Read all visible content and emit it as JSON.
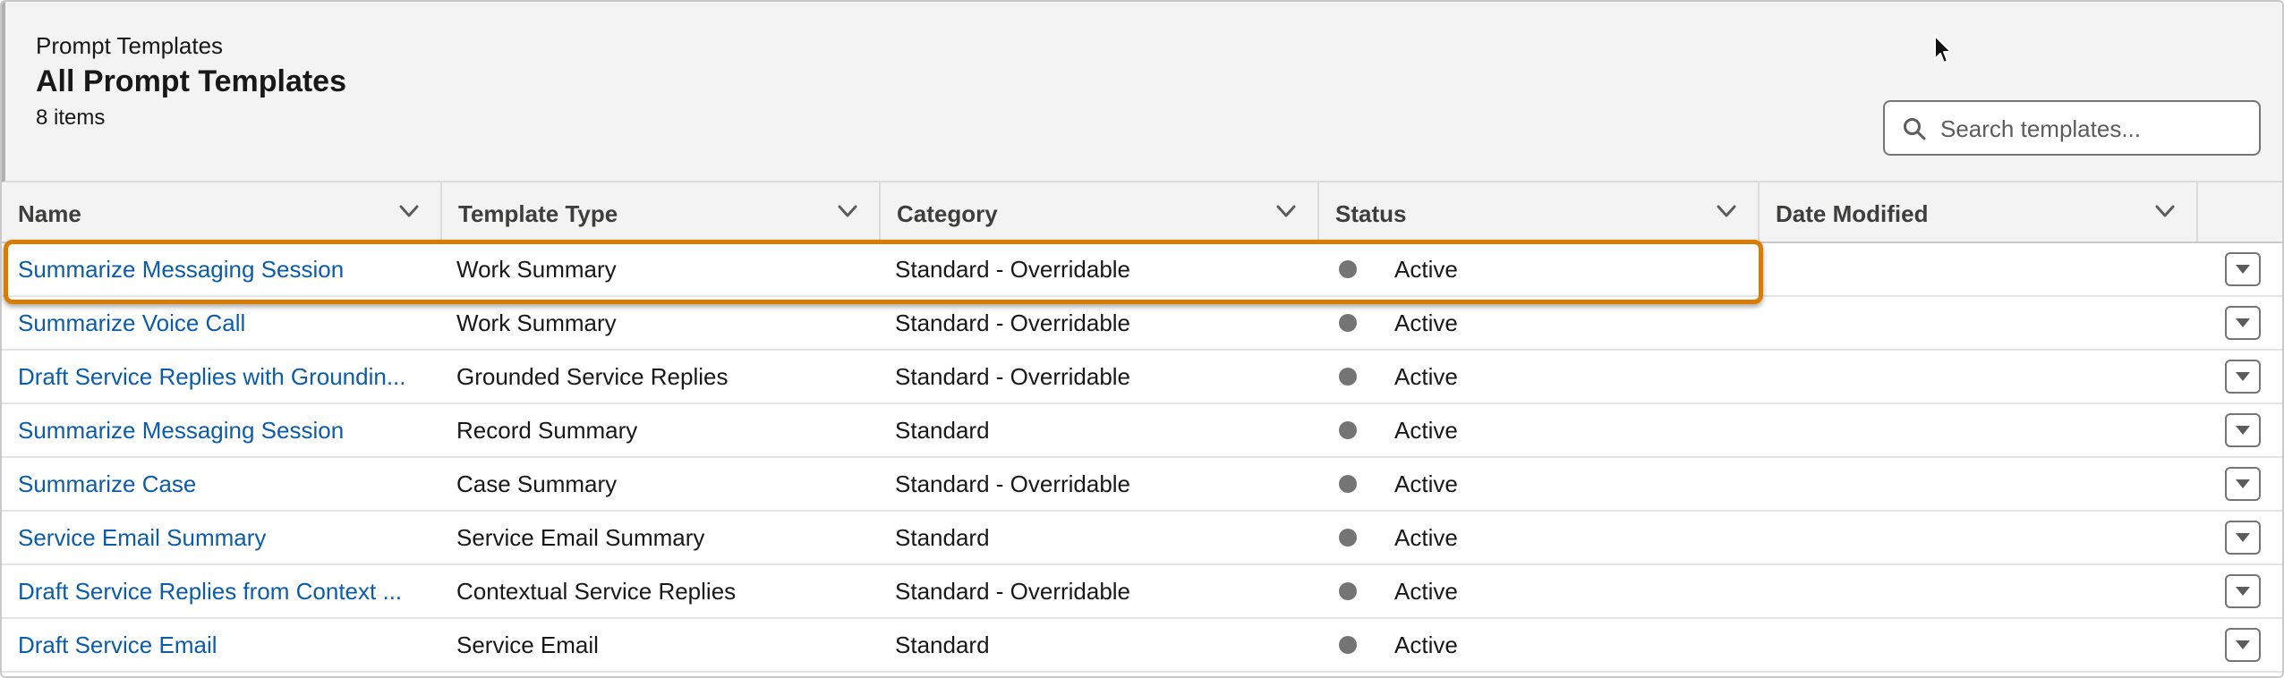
{
  "header": {
    "breadcrumb": "Prompt Templates",
    "title": "All Prompt Templates",
    "item_count": "8 items"
  },
  "search": {
    "placeholder": "Search templates...",
    "value": ""
  },
  "columns": [
    {
      "label": "Name"
    },
    {
      "label": "Template Type"
    },
    {
      "label": "Category"
    },
    {
      "label": "Status"
    },
    {
      "label": "Date Modified"
    }
  ],
  "rows": [
    {
      "name": "Summarize Messaging Session",
      "type": "Work Summary",
      "category": "Standard - Overridable",
      "status": "Active",
      "date_modified": ""
    },
    {
      "name": "Summarize Voice Call",
      "type": "Work Summary",
      "category": "Standard - Overridable",
      "status": "Active",
      "date_modified": ""
    },
    {
      "name": "Draft Service Replies with Groundin...",
      "type": "Grounded Service Replies",
      "category": "Standard - Overridable",
      "status": "Active",
      "date_modified": ""
    },
    {
      "name": "Summarize Messaging Session",
      "type": "Record Summary",
      "category": "Standard",
      "status": "Active",
      "date_modified": ""
    },
    {
      "name": "Summarize Case",
      "type": "Case Summary",
      "category": "Standard - Overridable",
      "status": "Active",
      "date_modified": ""
    },
    {
      "name": "Service Email Summary",
      "type": "Service Email Summary",
      "category": "Standard",
      "status": "Active",
      "date_modified": ""
    },
    {
      "name": "Draft Service Replies from Context ...",
      "type": "Contextual Service Replies",
      "category": "Standard - Overridable",
      "status": "Active",
      "date_modified": ""
    },
    {
      "name": "Draft Service Email",
      "type": "Service Email",
      "category": "Standard",
      "status": "Active",
      "date_modified": ""
    }
  ],
  "icons": {
    "search": "search-icon",
    "column_sort": "chevron-down-icon",
    "row_action": "row-action-menu-icon",
    "status": "status-dot-icon",
    "cursor": "mouse-pointer-icon"
  },
  "colors": {
    "link": "#0b5cab",
    "highlight": "#d97c00",
    "status_dot": "#747474",
    "header_bg": "#f3f3f3"
  }
}
